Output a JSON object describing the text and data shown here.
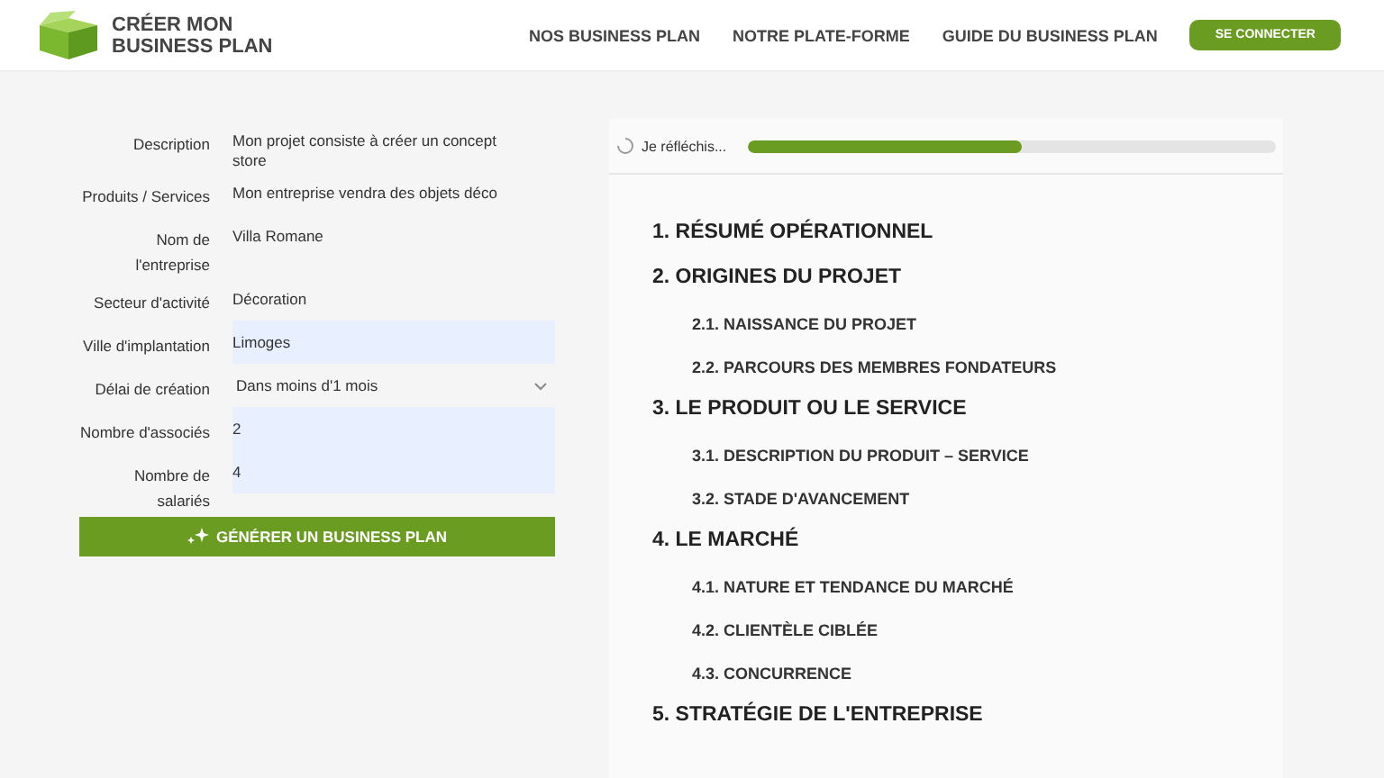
{
  "header": {
    "logo_line1": "CRÉER MON",
    "logo_line2": "BUSINESS PLAN",
    "nav": [
      {
        "label": "NOS BUSINESS PLAN"
      },
      {
        "label": "NOTRE PLATE-FORME"
      },
      {
        "label": "GUIDE DU BUSINESS PLAN"
      }
    ],
    "login": "SE CONNECTER"
  },
  "form": {
    "fields": [
      {
        "label": "Description",
        "value": "Mon projet consiste à créer un concept store",
        "kind": "text"
      },
      {
        "label": "Produits / Services",
        "value": "Mon entreprise vendra des objets déco",
        "kind": "text"
      },
      {
        "label": "Nom de l'entreprise",
        "value": "Villa Romane",
        "kind": "text"
      },
      {
        "label": "Secteur d'activité",
        "value": "Décoration",
        "kind": "text"
      },
      {
        "label": "Ville d'implantation",
        "value": "Limoges",
        "kind": "input"
      },
      {
        "label": "Délai de création",
        "value": "Dans moins d'1 mois",
        "kind": "select"
      },
      {
        "label": "Nombre d'associés",
        "value": "2",
        "kind": "input"
      },
      {
        "label": "Nombre de salariés",
        "value": "4",
        "kind": "input"
      }
    ],
    "submit": "GÉNÉRER UN BUSINESS PLAN"
  },
  "progress": {
    "label": "Je réfléchis...",
    "level": 0.52
  },
  "outline": [
    {
      "title": "1. RÉSUMÉ OPÉRATIONNEL"
    },
    {
      "title": "2. ORIGINES DU PROJET",
      "children": [
        {
          "title": "2.1. NAISSANCE DU PROJET"
        },
        {
          "title": "2.2. PARCOURS DES MEMBRES FONDATEURS"
        }
      ]
    },
    {
      "title": "3. LE PRODUIT OU LE SERVICE",
      "children": [
        {
          "title": "3.1. DESCRIPTION DU PRODUIT – SERVICE"
        },
        {
          "title": "3.2. STADE D'AVANCEMENT"
        }
      ]
    },
    {
      "title": "4. LE MARCHÉ",
      "children": [
        {
          "title": "4.1. NATURE ET TENDANCE DU MARCHÉ"
        },
        {
          "title": "4.2. CLIENTÈLE CIBLÉE"
        },
        {
          "title": "4.3. CONCURRENCE"
        }
      ]
    },
    {
      "title": "5. STRATÉGIE DE L'ENTREPRISE"
    }
  ]
}
